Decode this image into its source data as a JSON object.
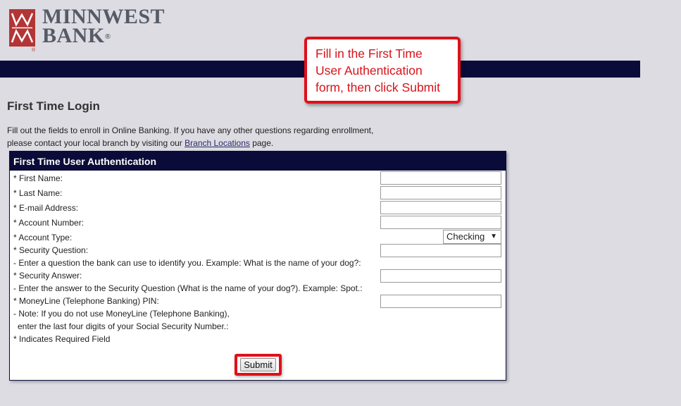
{
  "bank": {
    "name_line1": "MINNWEST",
    "name_line2": "BANK",
    "reg_mark": "®",
    "logo_mark_reg": "®"
  },
  "callout": {
    "line1": "Fill in the First Time",
    "line2": "User Authentication",
    "line3": "form, then click Submit"
  },
  "page": {
    "title": "First Time Login",
    "intro_line1": "Fill out the fields to enroll in Online Banking. If you have any other questions regarding enrollment,",
    "intro_line2_pre": "please contact your local branch by visiting our ",
    "intro_link": "Branch Locations",
    "intro_line2_post": " page."
  },
  "form": {
    "header": "First Time User Authentication",
    "labels": {
      "first_name": "* First Name:",
      "last_name": "* Last Name:",
      "email": "* E-mail Address:",
      "account_number": "* Account Number:",
      "account_type": "* Account Type:",
      "security_question": "* Security Question:",
      "security_question_hint": "- Enter a question the bank can use to identify you. Example: What is the name of your dog?:",
      "security_answer": "* Security Answer:",
      "security_answer_hint": "- Enter the answer to the Security Question (What is the name of your dog?). Example: Spot.:",
      "pin": "* MoneyLine (Telephone Banking) PIN:",
      "pin_note1": "- Note: If you do not use MoneyLine (Telephone Banking),",
      "pin_note2": "enter the last four digits of your Social Security Number.:",
      "required_note": "* Indicates Required Field"
    },
    "values": {
      "first_name": "",
      "last_name": "",
      "email": "",
      "account_number": "",
      "security_question": "",
      "security_answer": "",
      "pin": ""
    },
    "account_type_selected": "Checking",
    "submit_label": "Submit"
  },
  "colors": {
    "navbar": "#0b0b3a",
    "callout_border": "#e0101a",
    "logo_red": "#b33535"
  }
}
